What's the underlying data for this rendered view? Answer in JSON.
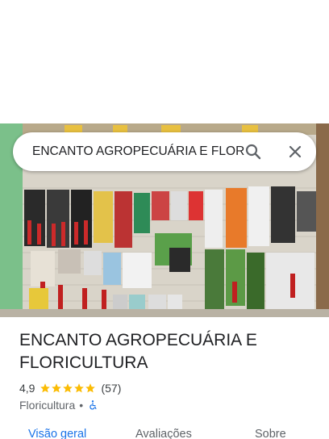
{
  "search": {
    "query": "ENCANTO AGROPECUÁRIA E FLORICULTURA",
    "search_icon": "search-icon",
    "close_icon": "close-icon"
  },
  "place": {
    "name": "ENCANTO AGROPECUÁRIA E FLORICULTURA",
    "rating": "4,9",
    "stars": 5,
    "reviews": "(57)",
    "category": "Floricultura",
    "separator": "•",
    "accessibility_icon": "wheelchair-icon"
  },
  "tabs": [
    {
      "label": "Visão geral",
      "active": true
    },
    {
      "label": "Avaliações",
      "active": false
    },
    {
      "label": "Sobre",
      "active": false
    }
  ],
  "colors": {
    "accent": "#1a73e8",
    "star": "#fbbc04",
    "text": "#202124",
    "muted": "#5f6368"
  }
}
